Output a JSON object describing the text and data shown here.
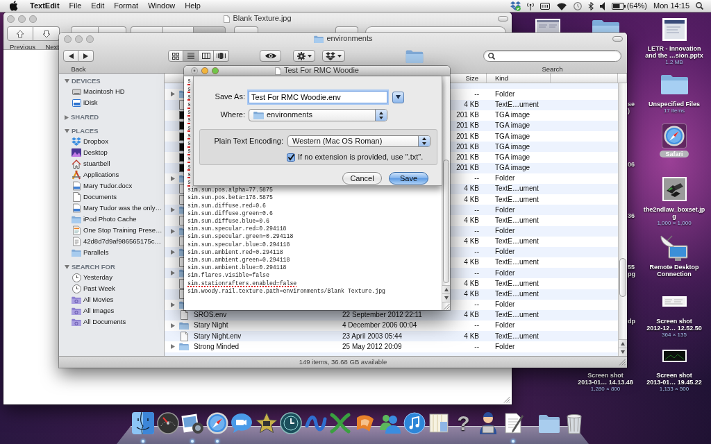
{
  "menu_bar": {
    "app": "TextEdit",
    "menus": [
      "File",
      "Edit",
      "Format",
      "Window",
      "Help"
    ],
    "battery_reading": "(64%)",
    "clock": "Mon 14:15"
  },
  "preview_window": {
    "title": "Blank Texture.jpg",
    "active": false,
    "toolbar_labels": [
      "Previous",
      "Next"
    ],
    "tool_segments": [
      {
        "selected": false
      },
      {
        "selected": false
      },
      {
        "selected": true
      }
    ]
  },
  "finder_window": {
    "title": "environments",
    "active": false,
    "back_label": "Back",
    "search_label": "Search",
    "view_modes": [
      {
        "kind": "icons",
        "selected": false
      },
      {
        "kind": "list",
        "selected": true
      },
      {
        "kind": "columns",
        "selected": false
      },
      {
        "kind": "coverflow",
        "selected": false
      }
    ],
    "sidebar": [
      {
        "heading": "DEVICES",
        "expanded": true,
        "items": [
          {
            "label": "Macintosh HD",
            "kind": "drive"
          },
          {
            "label": "iDisk",
            "kind": "idisk"
          }
        ]
      },
      {
        "heading": "SHARED",
        "expanded": false
      },
      {
        "heading": "PLACES",
        "expanded": true,
        "items": [
          {
            "label": "Dropbox",
            "kind": "dropbox"
          },
          {
            "label": "Desktop",
            "kind": "desktop"
          },
          {
            "label": "stuartbell",
            "kind": "home"
          },
          {
            "label": "Applications",
            "kind": "applications"
          },
          {
            "label": "Mary Tudor.docx",
            "kind": "word-doc"
          },
          {
            "label": "Documents",
            "kind": "document"
          },
          {
            "label": "Mary Tudor was the only…",
            "kind": "word-doc"
          },
          {
            "label": "iPod Photo Cache",
            "kind": "folder"
          },
          {
            "label": "One Stop Training Prese…",
            "kind": "presentation"
          },
          {
            "label": "42d8d7d9af986565175c…",
            "kind": "file"
          },
          {
            "label": "Parallels",
            "kind": "folder"
          }
        ]
      },
      {
        "heading": "SEARCH FOR",
        "expanded": true,
        "items": [
          {
            "label": "Yesterday",
            "kind": "clock"
          },
          {
            "label": "Past Week",
            "kind": "clock"
          },
          {
            "label": "All Movies",
            "kind": "smart-folder"
          },
          {
            "label": "All Images",
            "kind": "smart-folder"
          },
          {
            "label": "All Documents",
            "kind": "smart-folder"
          }
        ]
      }
    ],
    "table": {
      "columns": [
        "Size",
        "Kind"
      ],
      "rows": [
        {
          "kind": "folder",
          "size": "--",
          "kind_label": "Folder"
        },
        {
          "kind": "document",
          "size": "4 KB",
          "kind_label": "TextE…ument"
        },
        {
          "kind": "image",
          "size": "201 KB",
          "kind_label": "TGA image"
        },
        {
          "kind": "image",
          "size": "201 KB",
          "kind_label": "TGA image"
        },
        {
          "kind": "image",
          "size": "201 KB",
          "kind_label": "TGA image"
        },
        {
          "kind": "image",
          "size": "201 KB",
          "kind_label": "TGA image"
        },
        {
          "kind": "image",
          "size": "201 KB",
          "kind_label": "TGA image"
        },
        {
          "kind": "image",
          "size": "201 KB",
          "kind_label": "TGA image"
        },
        {
          "kind": "folder",
          "size": "--",
          "kind_label": "Folder"
        },
        {
          "kind": "document",
          "size": "4 KB",
          "kind_label": "TextE…ument"
        },
        {
          "kind": "document",
          "size": "4 KB",
          "kind_label": "TextE…ument"
        },
        {
          "kind": "folder",
          "size": "--",
          "kind_label": "Folder"
        },
        {
          "kind": "document",
          "size": "4 KB",
          "kind_label": "TextE…ument"
        },
        {
          "kind": "folder",
          "size": "--",
          "kind_label": "Folder"
        },
        {
          "kind": "document",
          "size": "4 KB",
          "kind_label": "TextE…ument"
        },
        {
          "kind": "folder",
          "size": "--",
          "kind_label": "Folder"
        },
        {
          "kind": "document",
          "size": "4 KB",
          "kind_label": "TextE…ument"
        },
        {
          "kind": "folder",
          "size": "--",
          "kind_label": "Folder"
        },
        {
          "kind": "document",
          "size": "4 KB",
          "kind_label": "TextE…ument"
        },
        {
          "kind": "document",
          "size": "4 KB",
          "kind_label": "TextE…ument"
        },
        {
          "kind": "folder",
          "size": "--",
          "kind_label": "Folder"
        },
        {
          "kind": "document",
          "name": "SROS.env",
          "date": "22 September 2012 22:11",
          "size": "4 KB",
          "kind_label": "TextE…ument"
        },
        {
          "kind": "folder",
          "name": "Stary Night",
          "date": "4 December 2006 00:04",
          "size": "--",
          "kind_label": "Folder"
        },
        {
          "kind": "document",
          "name": "Stary Night.env",
          "date": "23 April 2003 05:44",
          "size": "4 KB",
          "kind_label": "TextE…ument"
        },
        {
          "kind": "folder",
          "name": "Strong Minded",
          "date": "25 May 2012 20:09",
          "size": "--",
          "kind_label": "Folder"
        }
      ]
    },
    "status_bar": "149 items, 36.68 GB available"
  },
  "textedit_window": {
    "title": "Test For RMC Woodie",
    "active": true,
    "lines": [
      {
        "text": "s",
        "spell_error": true
      },
      {
        "text": "s",
        "spell_error": true
      },
      {
        "text": "s",
        "spell_error": true
      },
      {
        "text": "s",
        "spell_error": true
      },
      {
        "text": "s",
        "spell_error": true
      },
      {
        "text": "s",
        "spell_error": true
      },
      {
        "text": "s",
        "spell_error": true
      },
      {
        "text": "s",
        "spell_error": true
      },
      {
        "text": "s",
        "spell_error": true
      },
      {
        "text": "s",
        "spell_error": true
      },
      {
        "text": "s",
        "spell_error": true
      },
      {
        "text": "s",
        "spell_error": true
      },
      {
        "text": "s",
        "spell_error": true
      },
      {
        "text": "s",
        "spell_error": true
      },
      {
        "text": "sim.sun.pos.alpha=77.5875",
        "spell_error": false
      },
      {
        "text": "sim.sun.pos.beta=178.5875",
        "spell_error": false
      },
      {
        "text": "sim.sun.diffuse.red=0.6",
        "spell_error": false
      },
      {
        "text": "sim.sun.diffuse.green=0.6",
        "spell_error": false
      },
      {
        "text": "sim.sun.diffuse.blue=0.6",
        "spell_error": false
      },
      {
        "text": "sim.sun.specular.red=0.294118",
        "spell_error": false
      },
      {
        "text": "sim.sun.specular.green=0.294118",
        "spell_error": false
      },
      {
        "text": "sim.sun.specular.blue=0.294118",
        "spell_error": false
      },
      {
        "text": "sim.sun.ambient.red=0.294118",
        "spell_error": false
      },
      {
        "text": "sim.sun.ambient.green=0.294118",
        "spell_error": false
      },
      {
        "text": "sim.sun.ambient.blue=0.294118",
        "spell_error": false
      },
      {
        "text": "sim.flares.visible=false",
        "spell_error": false
      },
      {
        "text": "sim.stationrafters.enabled=false",
        "spell_error": true
      },
      {
        "text": "sim.woody.rail.texture.path=environments/Blank Texture.jpg",
        "spell_error": false
      }
    ],
    "save_sheet": {
      "save_as_label": "Save As:",
      "filename": "Test For RMC Woodie.env",
      "where_label": "Where:",
      "where_value": "environments",
      "encoding_label": "Plain Text Encoding:",
      "encoding_value": "Western (Mac OS Roman)",
      "extension_checkbox": {
        "label": "If no extension is provided, use \".txt\".",
        "checked": true
      },
      "buttons": [
        {
          "label": "Cancel",
          "default": false
        },
        {
          "label": "Save",
          "default": true
        }
      ]
    }
  },
  "desktop": {
    "icons": [
      {
        "kind": "window-thumbnail",
        "selected": false
      },
      {
        "kind": "folder",
        "selected": false
      },
      {
        "kind": "presentation",
        "label": [
          "LETR - Innovation",
          "and the …sion.pptx"
        ],
        "info": "1.2 MB",
        "selected": false
      },
      {
        "kind": "folder",
        "label": [
          "Unspecified Files"
        ],
        "info": "17 items",
        "selected": false
      },
      {
        "kind": "compass",
        "label": [
          "Safari"
        ],
        "selected": true
      },
      {
        "kind": "photo",
        "label": [
          "the2ndlaw_boxset.jp",
          "g"
        ],
        "info": "1,000 × 1,000",
        "selected": false
      },
      {
        "kind": "remote-desktop",
        "label": [
          "Remote Desktop",
          "Connection"
        ],
        "selected": false
      },
      {
        "kind": "screenshot-light",
        "label": [
          "Screen shot",
          "2012-12… 12.52.50"
        ],
        "info": "364 × 135",
        "selected": false
      },
      {
        "kind": "covered",
        "label": [
          "Screen shot",
          "2013-01… 14.13.48"
        ],
        "info": "1,280 × 800",
        "selected": false
      },
      {
        "kind": "screenshot-dark",
        "label": [
          "Screen shot",
          "2013-01… 19.45.22"
        ],
        "info": "1,133 × 500",
        "selected": false
      }
    ],
    "label_fragments": [
      {
        "lines": [
          "se",
          ")"
        ]
      },
      {
        "lines": [
          "06"
        ]
      },
      {
        "lines": [
          "36"
        ]
      },
      {
        "lines": [
          "55",
          "pg"
        ]
      },
      {
        "lines": [
          "dp"
        ]
      }
    ]
  },
  "dock": [
    {
      "kind": "face",
      "running": true
    },
    {
      "kind": "gauge",
      "running": false
    },
    {
      "kind": "photos",
      "running": true
    },
    {
      "kind": "compass",
      "running": true
    },
    {
      "kind": "chat",
      "running": false
    },
    {
      "kind": "star",
      "running": false
    },
    {
      "kind": "clock",
      "running": false
    },
    {
      "kind": "wave",
      "running": false
    },
    {
      "kind": "cross",
      "running": false
    },
    {
      "kind": "ribbon",
      "running": false
    },
    {
      "kind": "people",
      "running": false
    },
    {
      "kind": "music",
      "running": false
    },
    {
      "kind": "book",
      "running": false
    },
    {
      "kind": "glyph",
      "glyph": "?",
      "running": false
    },
    {
      "kind": "person",
      "running": false
    },
    {
      "kind": "document-pen",
      "running": true
    },
    {
      "kind": "folder",
      "running": false
    },
    {
      "kind": "trash",
      "running": false
    }
  ]
}
